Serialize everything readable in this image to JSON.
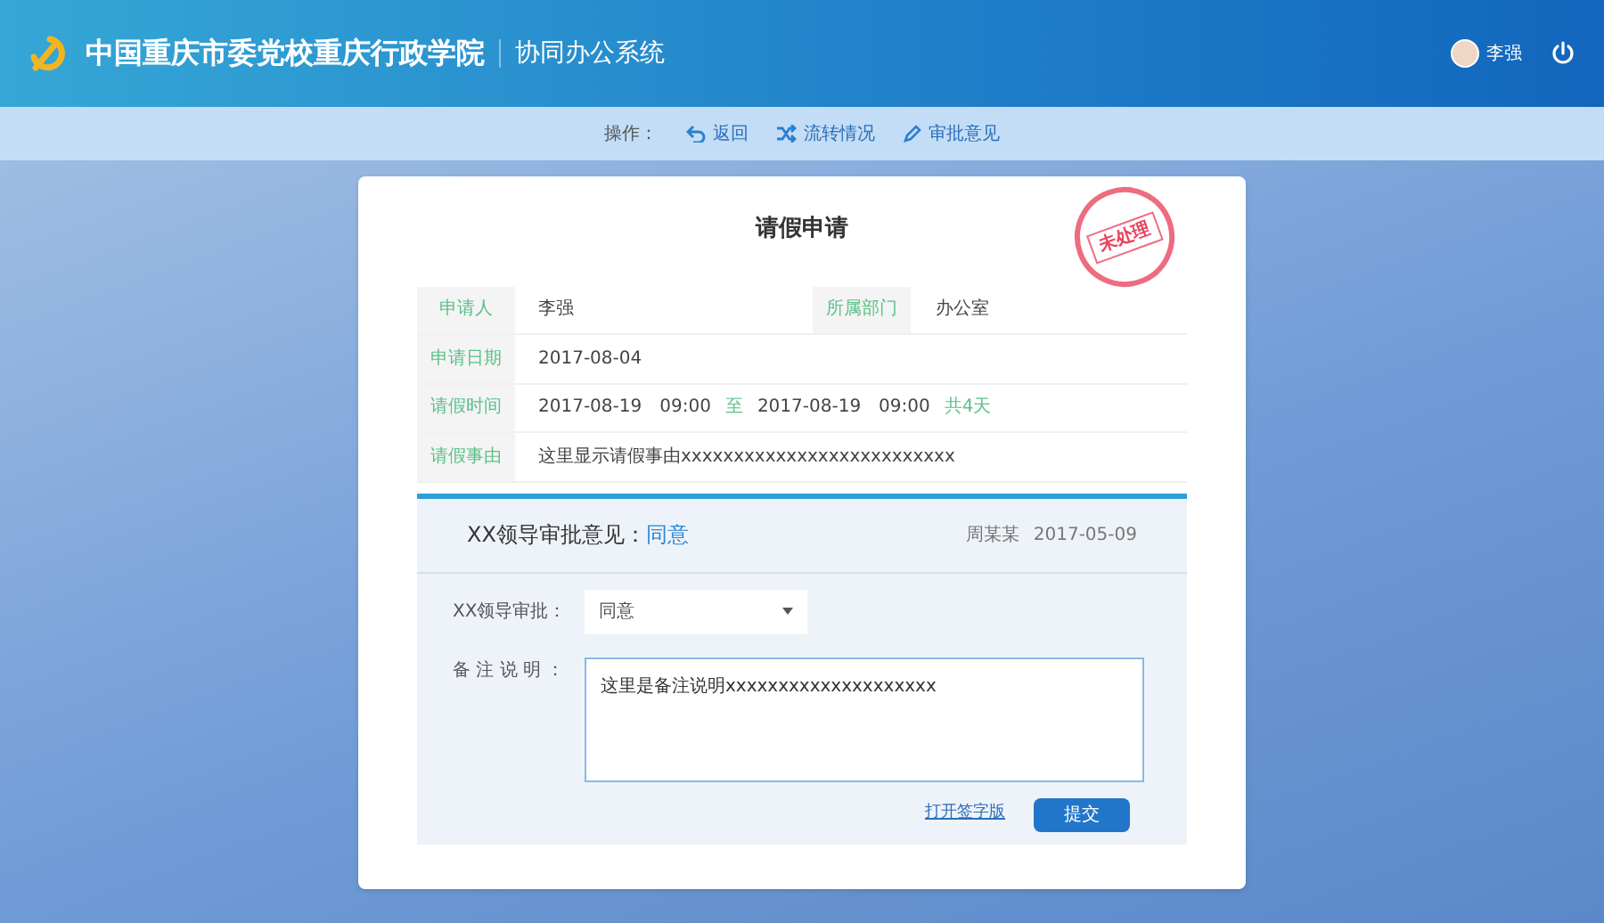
{
  "header": {
    "org_name": "中国重庆市委党校重庆行政学院",
    "system_name": "协同办公系统",
    "user_name": "李强"
  },
  "toolbar": {
    "label": "操作：",
    "actions": [
      {
        "kind": "back",
        "label": "返回"
      },
      {
        "kind": "flow",
        "label": "流转情况"
      },
      {
        "kind": "edit",
        "label": "审批意见"
      }
    ]
  },
  "form": {
    "title": "请假申请",
    "stamp": "未处理",
    "fields": [
      {
        "label": "申请人",
        "value": "李强",
        "extra_label": "所属部门",
        "extra_value": "办公室"
      },
      {
        "label": "申请日期",
        "value": "2017-08-04"
      },
      {
        "label": "请假时间",
        "start": "2017-08-19　09:00",
        "to": "至",
        "end": "2017-08-19　09:00",
        "total": "共4天"
      },
      {
        "label": "请假事由",
        "value": "这里显示请假事由xxxxxxxxxxxxxxxxxxxxxxxxxx"
      }
    ]
  },
  "approval": {
    "title": "XX领导审批意见：",
    "result": "同意",
    "approver": "周某某",
    "date": "2017-05-09",
    "select_label": "XX领导审批：",
    "select_value": "同意",
    "note_label": "备 注 说 明 ：",
    "note_value": "这里是备注说明xxxxxxxxxxxxxxxxxxxx",
    "link": "打开签字版",
    "submit": "提交"
  }
}
